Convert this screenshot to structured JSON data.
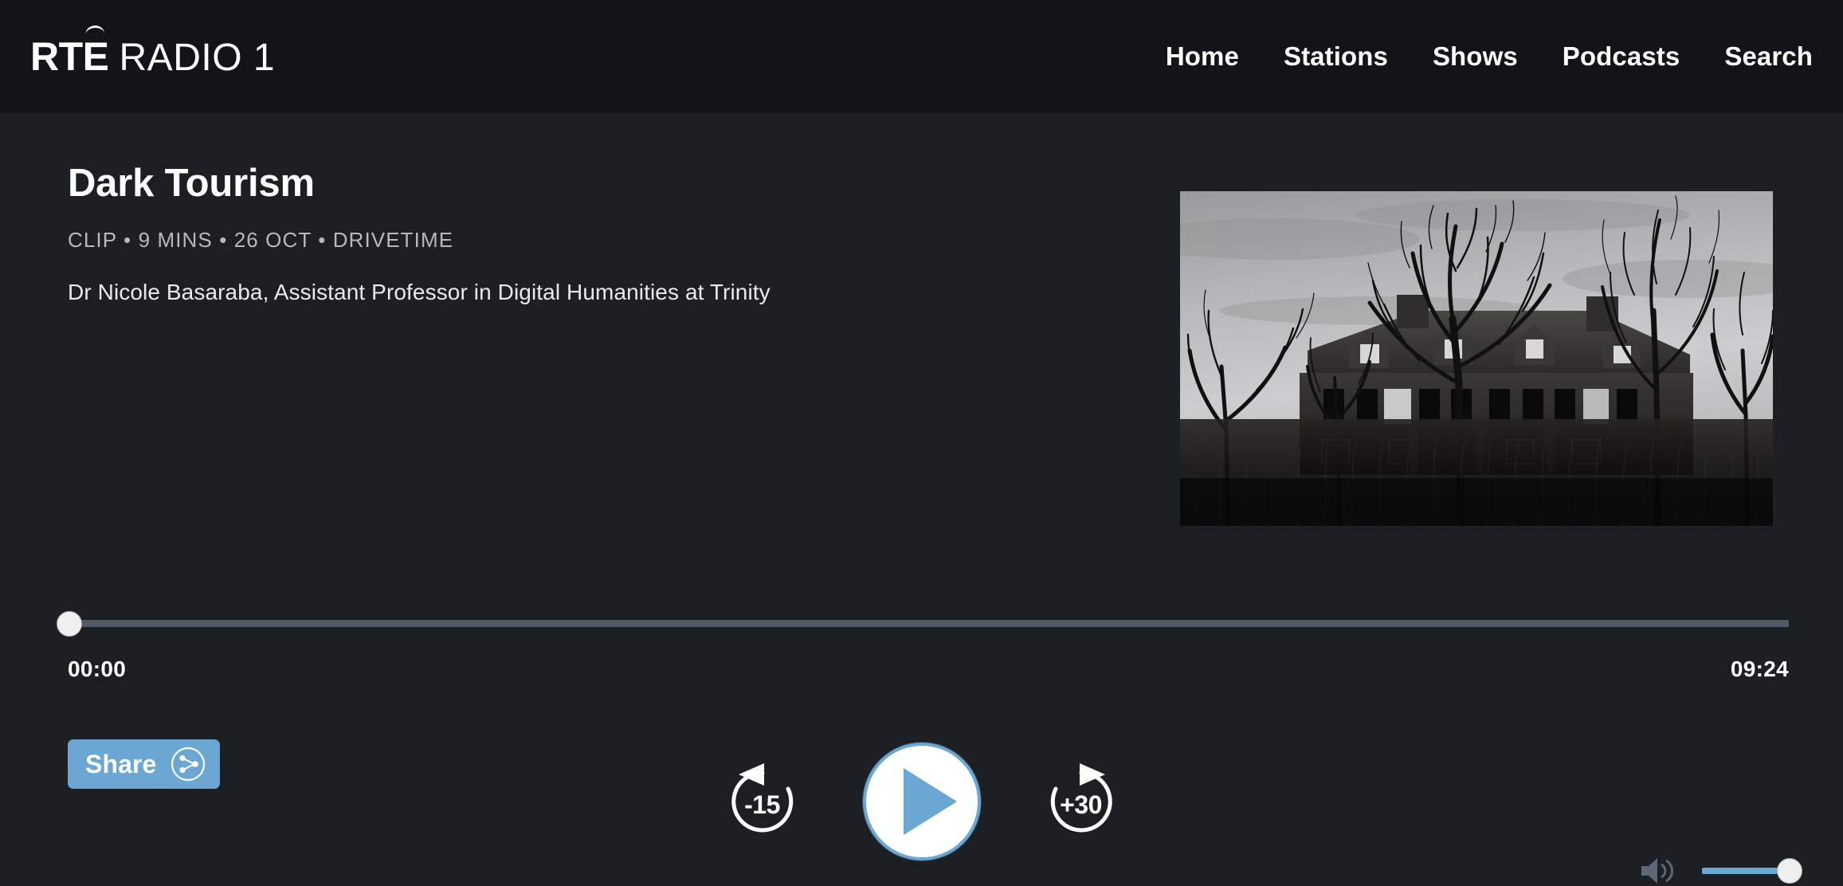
{
  "header": {
    "brand": {
      "primary": "RTÉ",
      "secondary": "RADIO 1"
    },
    "nav": [
      {
        "label": "Home",
        "name": "nav-home"
      },
      {
        "label": "Stations",
        "name": "nav-stations"
      },
      {
        "label": "Shows",
        "name": "nav-shows"
      },
      {
        "label": "Podcasts",
        "name": "nav-podcasts"
      },
      {
        "label": "Search",
        "name": "nav-search"
      }
    ]
  },
  "episode": {
    "title": "Dark Tourism",
    "meta": "CLIP • 9 MINS • 26 OCT • DRIVETIME",
    "description": "Dr Nicole Basaraba, Assistant Professor in Digital Humanities at Trinity",
    "artwork_alt": "Black and white photograph of an abandoned derelict mansion behind bare winter trees and tall grass"
  },
  "player": {
    "current_time": "00:00",
    "total_time": "09:24",
    "progress_percent": 0,
    "rewind_label": "-15",
    "forward_label": "+30",
    "play_state": "paused",
    "volume_percent": 100,
    "icons": {
      "rewind": "rewind-15-icon",
      "play": "play-icon",
      "forward": "forward-30-icon",
      "volume": "volume-icon",
      "share": "share-network-icon"
    }
  },
  "share": {
    "label": "Share"
  },
  "colors": {
    "header_bg": "#131417",
    "body_bg": "#1c1f24",
    "accent_blue": "#6ba7d2",
    "track_gray": "#525a68",
    "meta_gray": "#b6bac0",
    "text_white": "#ffffff"
  }
}
